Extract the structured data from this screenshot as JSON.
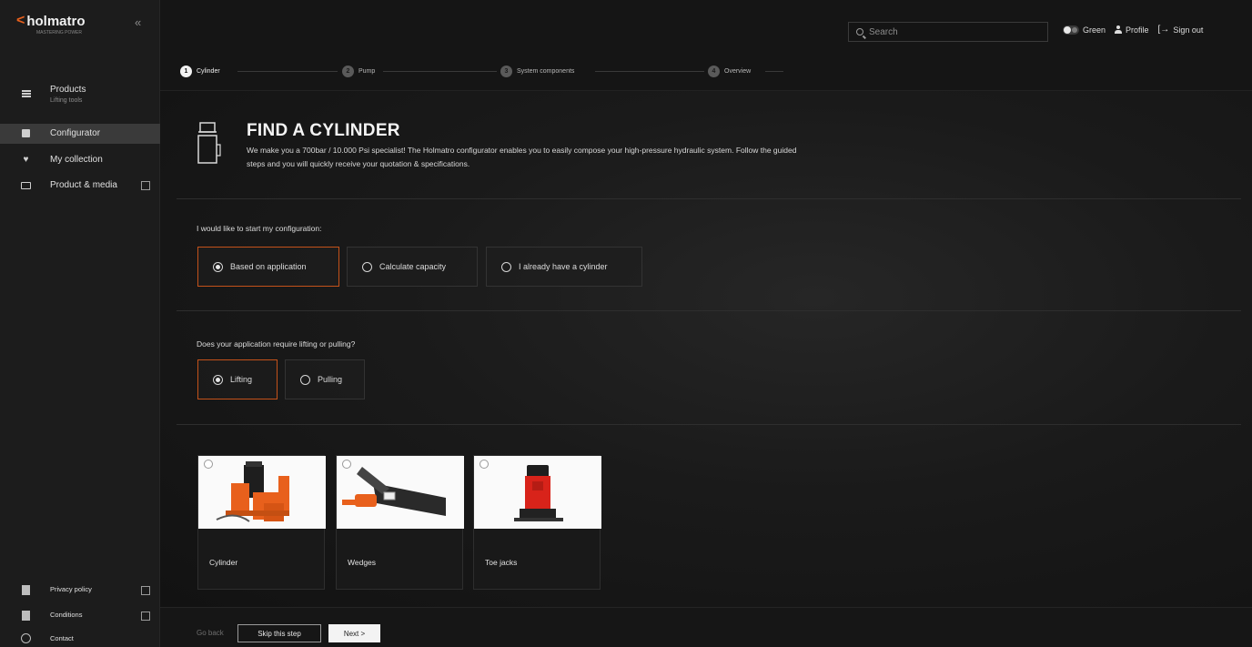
{
  "brand": {
    "logo_mark": "<",
    "name": "holmatro",
    "tagline": "MASTERING POWER"
  },
  "sidebar": {
    "collapse_icon": "chevron-double-left-icon",
    "items": [
      {
        "label": "Products",
        "sub": "Lifting tools",
        "icon": "list-icon"
      },
      {
        "label": "Configurator",
        "icon": "configurator-icon"
      },
      {
        "label": "My collection",
        "icon": "heart-icon"
      },
      {
        "label": "Product & media",
        "icon": "monitor-icon"
      }
    ],
    "footer": [
      {
        "label": "Privacy policy",
        "icon": "document-icon"
      },
      {
        "label": "Conditions",
        "icon": "document-icon"
      },
      {
        "label": "Contact",
        "icon": "info-icon"
      }
    ]
  },
  "topbar": {
    "search_placeholder": "Search",
    "theme_label": "Green",
    "profile_label": "Profile",
    "signout_label": "Sign out"
  },
  "steps": [
    {
      "num": "1",
      "label": "Cylinder",
      "active": true
    },
    {
      "num": "2",
      "label": "Pump",
      "active": false
    },
    {
      "num": "3",
      "label": "System components",
      "active": false
    },
    {
      "num": "4",
      "label": "Overview",
      "active": false
    }
  ],
  "hero": {
    "title": "FIND A CYLINDER",
    "desc": "We make you a 700bar / 10.000 Psi specialist! The Holmatro configurator enables you to easily compose your high-pressure hydraulic system. Follow the guided steps and you will quickly receive your quotation & specifications."
  },
  "q1": {
    "label": "I would like to start my configuration:",
    "options": [
      "Based on application",
      "Calculate capacity",
      "I already have a cylinder"
    ],
    "selected": "Based on application"
  },
  "q2": {
    "label": "Does your application require lifting or pulling?",
    "options": [
      "Lifting",
      "Pulling"
    ],
    "selected": "Lifting"
  },
  "products": [
    {
      "name": "Cylinder"
    },
    {
      "name": "Wedges"
    },
    {
      "name": "Toe jacks"
    }
  ],
  "footer": {
    "back": "Go back",
    "skip": "Skip this step",
    "next": "Next >"
  },
  "colors": {
    "accent": "#c4521a",
    "brand_orange": "#e8601c"
  }
}
